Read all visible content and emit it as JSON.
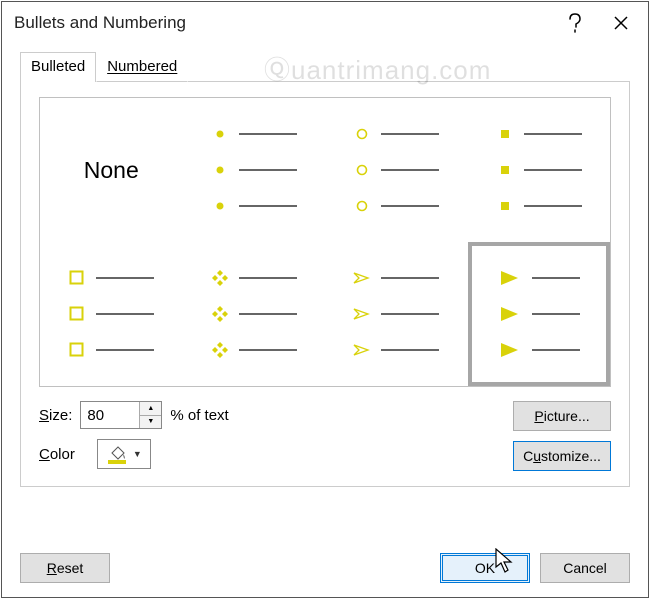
{
  "title": "Bullets and Numbering",
  "tabs": {
    "bulleted": "Bulleted",
    "numbered": "Numbered"
  },
  "none_label": "None",
  "size_label": "Size:",
  "size_value": "80",
  "pct_text": "% of text",
  "color_label": "Color",
  "picture_btn": "Picture...",
  "customize_btn": "Customize...",
  "reset_btn": "Reset",
  "ok_btn": "OK",
  "cancel_btn": "Cancel",
  "bullet_color": "#d9d20a",
  "watermark": "Ⓠuantrimang.com"
}
